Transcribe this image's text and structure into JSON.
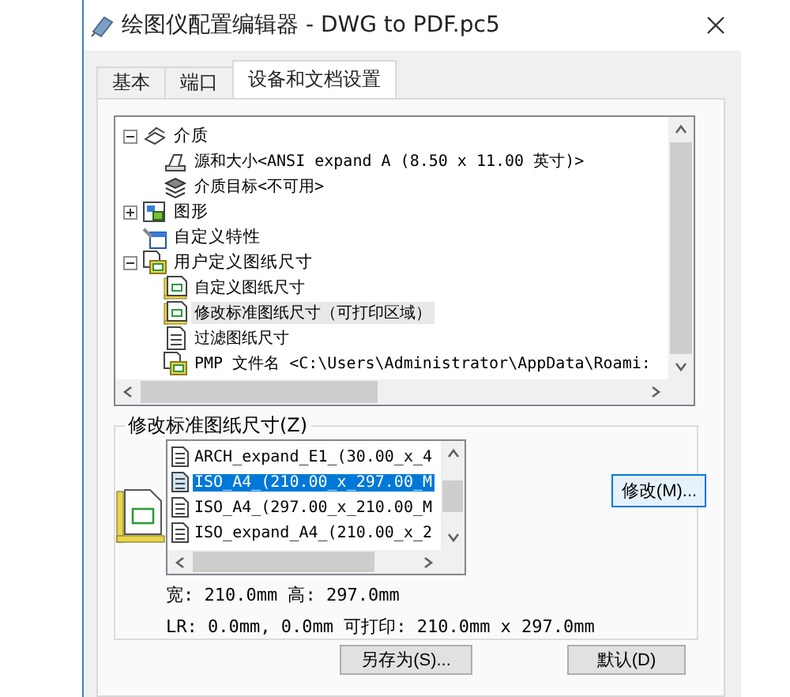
{
  "window": {
    "title": "绘图仪配置编辑器 - DWG to PDF.pc5"
  },
  "tabs": [
    {
      "label": "基本",
      "selected": false
    },
    {
      "label": "端口",
      "selected": false
    },
    {
      "label": "设备和文档设置",
      "selected": true
    }
  ],
  "tree": {
    "nodes": [
      {
        "label": "介质",
        "kind": "media",
        "expanded": true,
        "selected": false,
        "children": [
          {
            "label": "源和大小<ANSI expand A (8.50 x 11.00 英寸)>",
            "kind": "source",
            "selected": false
          },
          {
            "label": "介质目标<不可用>",
            "kind": "layers",
            "selected": false
          }
        ]
      },
      {
        "label": "图形",
        "kind": "graphics",
        "expanded": false,
        "selected": false
      },
      {
        "label": "自定义特性",
        "kind": "properties",
        "selected": false
      },
      {
        "label": "用户定义图纸尺寸",
        "kind": "paper-sizes",
        "expanded": true,
        "selected": false,
        "children": [
          {
            "label": "自定义图纸尺寸",
            "kind": "paper",
            "selected": false
          },
          {
            "label": "修改标准图纸尺寸（可打印区域）",
            "kind": "paper",
            "selected": true
          },
          {
            "label": "过滤图纸尺寸",
            "kind": "document",
            "selected": false
          },
          {
            "label": "PMP 文件名 <C:\\Users\\Administrator\\AppData\\Roami:",
            "kind": "paper-sizes",
            "selected": false
          }
        ]
      }
    ]
  },
  "paper_sizes": {
    "label": "修改标准图纸尺寸(Z)",
    "items": [
      {
        "label": "ARCH_expand_E1_(30.00_x_4",
        "selected": false
      },
      {
        "label": "ISO_A4_(210.00_x_297.00_M",
        "selected": true
      },
      {
        "label": "ISO_A4_(297.00_x_210.00_M",
        "selected": false
      },
      {
        "label": "ISO_expand_A4_(210.00_x_2",
        "selected": false
      }
    ],
    "modify_button": "修改(M)...",
    "dimensions": "宽: 210.0mm 高: 297.0mm",
    "printable": "LR: 0.0mm, 0.0mm 可打印: 210.0mm x 297.0mm"
  },
  "buttons": [
    {
      "label": "另存为(S)..."
    },
    {
      "label": "默认(D)"
    }
  ]
}
